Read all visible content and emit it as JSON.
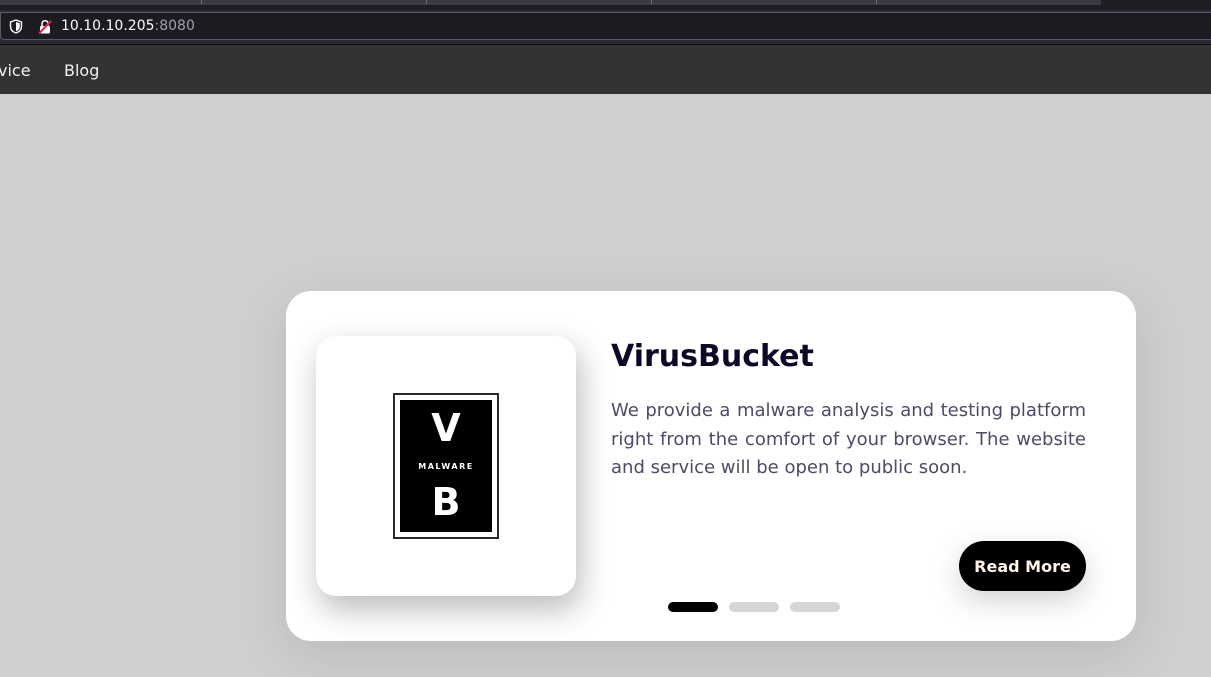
{
  "browser": {
    "url_host": "10.10.10.205",
    "url_port": ":8080",
    "icons": [
      "shield-icon",
      "insecure-lock-icon"
    ]
  },
  "navbar": {
    "items": [
      {
        "label": "vice"
      },
      {
        "label": "Blog"
      }
    ]
  },
  "card": {
    "title": "VirusBucket",
    "description": "We provide a malware analysis and testing platform right from the comfort of your browser. The website and service will be open to public soon.",
    "button_label": "Read More",
    "logo": {
      "top": "V",
      "middle": "MALWARE",
      "bottom": "B"
    },
    "pagination": {
      "count": 3,
      "active_index": 0
    }
  },
  "colors": {
    "page_bg": "#cfcfcf",
    "navbar_bg": "#333333",
    "title": "#0d0925",
    "text": "#4e4a67",
    "button_bg": "#000000",
    "button_text": "#fff5e8"
  }
}
